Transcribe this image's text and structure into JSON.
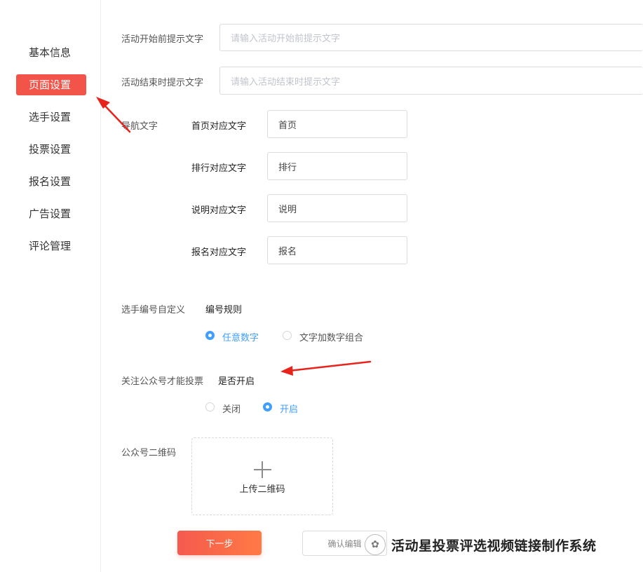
{
  "sidebar": {
    "items": [
      {
        "label": "基本信息",
        "active": false
      },
      {
        "label": "页面设置",
        "active": true
      },
      {
        "label": "选手设置",
        "active": false
      },
      {
        "label": "投票设置",
        "active": false
      },
      {
        "label": "报名设置",
        "active": false
      },
      {
        "label": "广告设置",
        "active": false
      },
      {
        "label": "评论管理",
        "active": false
      }
    ]
  },
  "form": {
    "start_tip": {
      "label": "活动开始前提示文字",
      "placeholder": "请输入活动开始前提示文字"
    },
    "end_tip": {
      "label": "活动结束时提示文字",
      "placeholder": "请输入活动结束时提示文字"
    },
    "nav": {
      "label": "导航文字",
      "fields": [
        {
          "label": "首页对应文字",
          "value": "首页"
        },
        {
          "label": "排行对应文字",
          "value": "排行"
        },
        {
          "label": "说明对应文字",
          "value": "说明"
        },
        {
          "label": "报名对应文字",
          "value": "报名"
        }
      ]
    },
    "numbering": {
      "label": "选手编号自定义",
      "sub_label": "编号规则",
      "options": [
        {
          "label": "任意数字",
          "selected": true
        },
        {
          "label": "文字加数字组合",
          "selected": false
        }
      ]
    },
    "follow": {
      "label": "关注公众号才能投票",
      "sub_label": "是否开启",
      "options": [
        {
          "label": "关闭",
          "selected": false
        },
        {
          "label": "开启",
          "selected": true
        }
      ]
    },
    "qrcode": {
      "label": "公众号二维码",
      "upload_label": "上传二维码"
    }
  },
  "buttons": {
    "next": "下一步",
    "confirm": "确认编辑"
  },
  "watermark": {
    "icon": "wechat-icon",
    "text": "活动星投票评选视频链接制作系统"
  },
  "colors": {
    "accent": "#f2544a",
    "radio_on": "#409eff",
    "annotation_arrow": "#e8231b"
  }
}
